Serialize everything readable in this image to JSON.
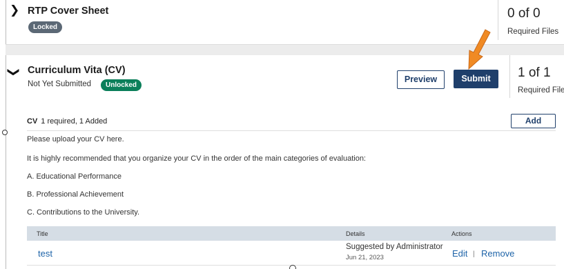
{
  "rtp": {
    "title": "RTP Cover Sheet",
    "badge": "Locked",
    "count": "0 of 0",
    "count_label": "Required Files"
  },
  "cv": {
    "title": "Curriculum Vita (CV)",
    "status": "Not Yet Submitted",
    "badge": "Unlocked",
    "preview_label": "Preview",
    "submit_label": "Submit",
    "count": "1 of 1",
    "count_label": "Required Files",
    "section": {
      "name": "CV",
      "summary": "1 required, 1 Added",
      "add_label": "Add"
    },
    "instructions": [
      "Please upload your CV here.",
      "It is highly recommended that you organize your CV in the order of the main categories of evaluation:",
      "A. Educational Performance",
      "B. Professional Achievement",
      "C. Contributions to the University."
    ],
    "table": {
      "headers": {
        "title": "Title",
        "details": "Details",
        "actions": "Actions"
      },
      "rows": [
        {
          "title": "test",
          "details": "Suggested by Administrator",
          "date": "Jun 21, 2023",
          "edit": "Edit",
          "separator": "|",
          "remove": "Remove"
        }
      ]
    }
  },
  "icons": {
    "collapsed": "chevron-right-icon",
    "expanded": "chevron-down-icon",
    "annotation": "orange-arrow-icon"
  },
  "colors": {
    "primary": "#1f3f6b",
    "link": "#1d63a8",
    "locked": "#5b6875",
    "unlocked": "#0b7f5a",
    "annotation": "#f08a24"
  }
}
